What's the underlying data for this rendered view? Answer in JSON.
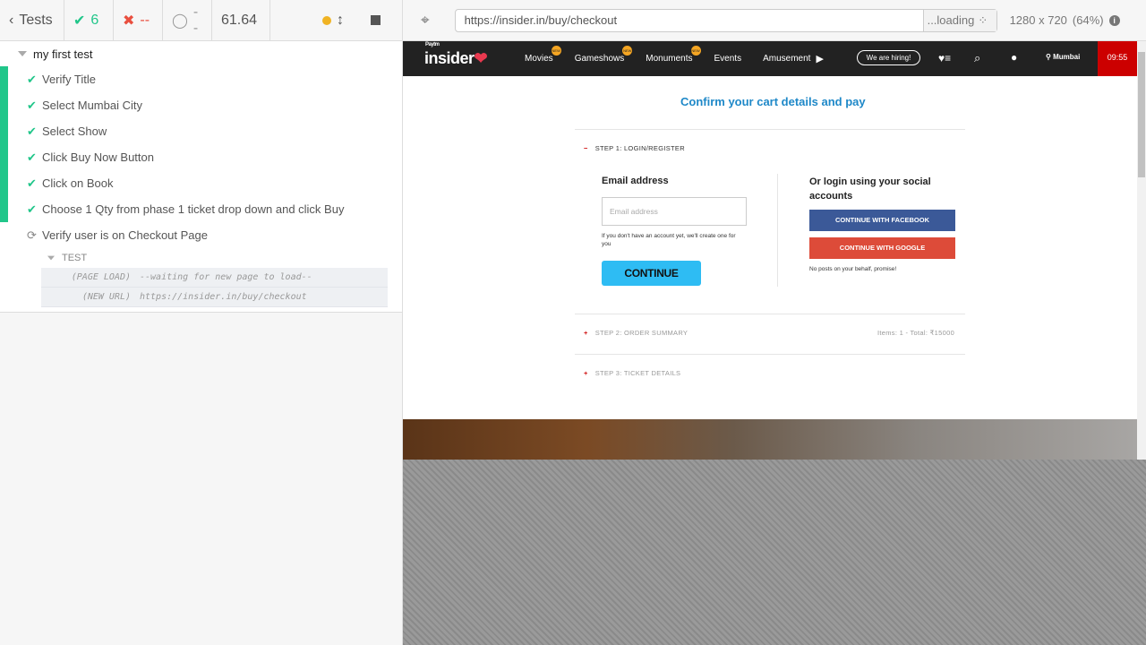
{
  "reporter": {
    "back_label": "Tests",
    "passed": "6",
    "failed": "--",
    "pending": "--",
    "duration": "61.64",
    "suite_title": "my first test",
    "tests": [
      {
        "label": "Verify Title",
        "state": "passed"
      },
      {
        "label": "Select Mumbai City",
        "state": "passed"
      },
      {
        "label": "Select Show",
        "state": "passed"
      },
      {
        "label": "Click Buy Now Button",
        "state": "passed"
      },
      {
        "label": "Click on Book",
        "state": "passed"
      },
      {
        "label": "Choose 1 Qty from phase 1 ticket drop down and click Buy",
        "state": "passed"
      },
      {
        "label": "Verify user is on Checkout Page",
        "state": "running"
      }
    ],
    "section_label": "TEST",
    "commands": [
      {
        "name": "(PAGE LOAD)",
        "message": "--waiting for new page to load--"
      },
      {
        "name": "(NEW URL)",
        "message": "https://insider.in/buy/checkout"
      }
    ]
  },
  "aut": {
    "url": "https://insider.in/buy/checkout",
    "loading": "...loading",
    "viewport": "1280 x 720",
    "scale": "(64%)"
  },
  "site": {
    "logo_small": "Paytm",
    "logo": "insider",
    "nav": [
      "Movies",
      "Gameshows",
      "Monuments",
      "Events",
      "Amusement"
    ],
    "badge": "NEW",
    "hiring": "We are hiring!",
    "city": "Mumbai",
    "timer": "09:55",
    "heading": "Confirm your cart details and pay",
    "step1": "STEP 1: LOGIN/REGISTER",
    "email_label": "Email address",
    "email_placeholder": "Email address",
    "no_account": "If you don't have an account yet, we'll create one for you",
    "continue": "CONTINUE",
    "social_title": "Or login using your social accounts",
    "facebook": "CONTINUE WITH FACEBOOK",
    "google": "CONTINUE WITH GOOGLE",
    "no_posts": "No posts on your behalf, promise!",
    "step2": "STEP 2: ORDER SUMMARY",
    "step2_meta": "Items: 1 - Total: ₹15000",
    "step3": "STEP 3: TICKET DETAILS",
    "colors": {
      "facebook": "#3b5998",
      "google": "#dd4b39",
      "accent": "#2ebcf3",
      "timer": "#cc0000"
    }
  }
}
